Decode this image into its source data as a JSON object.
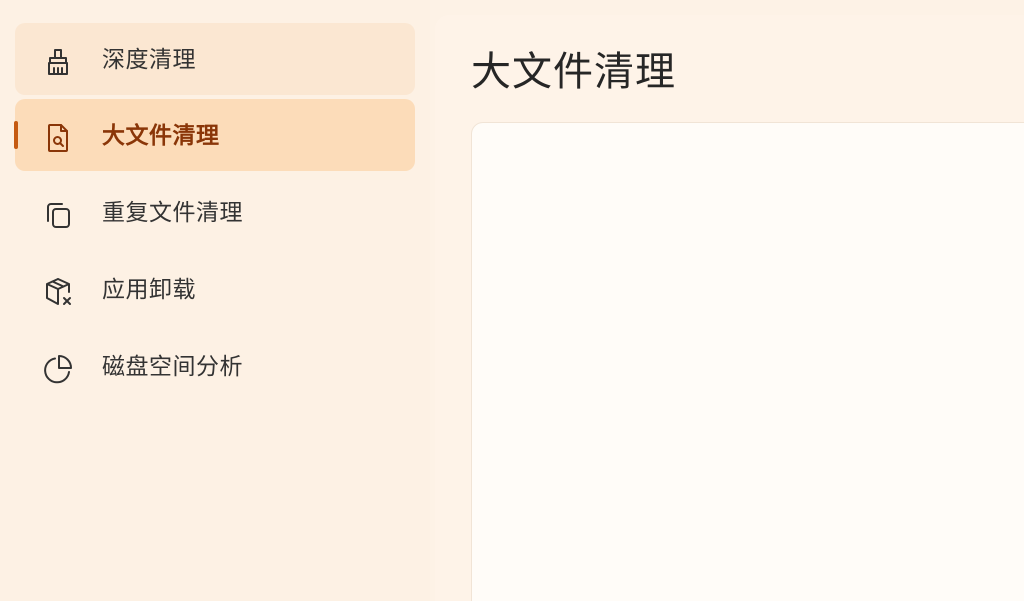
{
  "sidebar": {
    "items": [
      {
        "label": "深度清理",
        "icon": "broom-icon",
        "state": "hover"
      },
      {
        "label": "大文件清理",
        "icon": "file-search-icon",
        "state": "active"
      },
      {
        "label": "重复文件清理",
        "icon": "copy-icon",
        "state": "normal"
      },
      {
        "label": "应用卸载",
        "icon": "package-remove-icon",
        "state": "normal"
      },
      {
        "label": "磁盘空间分析",
        "icon": "pie-chart-icon",
        "state": "normal"
      }
    ]
  },
  "main": {
    "title": "大文件清理"
  },
  "colors": {
    "accent": "#c55a11",
    "active_bg": "#fcdcb9",
    "hover_bg": "#fbe7d2",
    "sidebar_bg": "#fdf1e4",
    "card_bg": "#fffcf8"
  }
}
